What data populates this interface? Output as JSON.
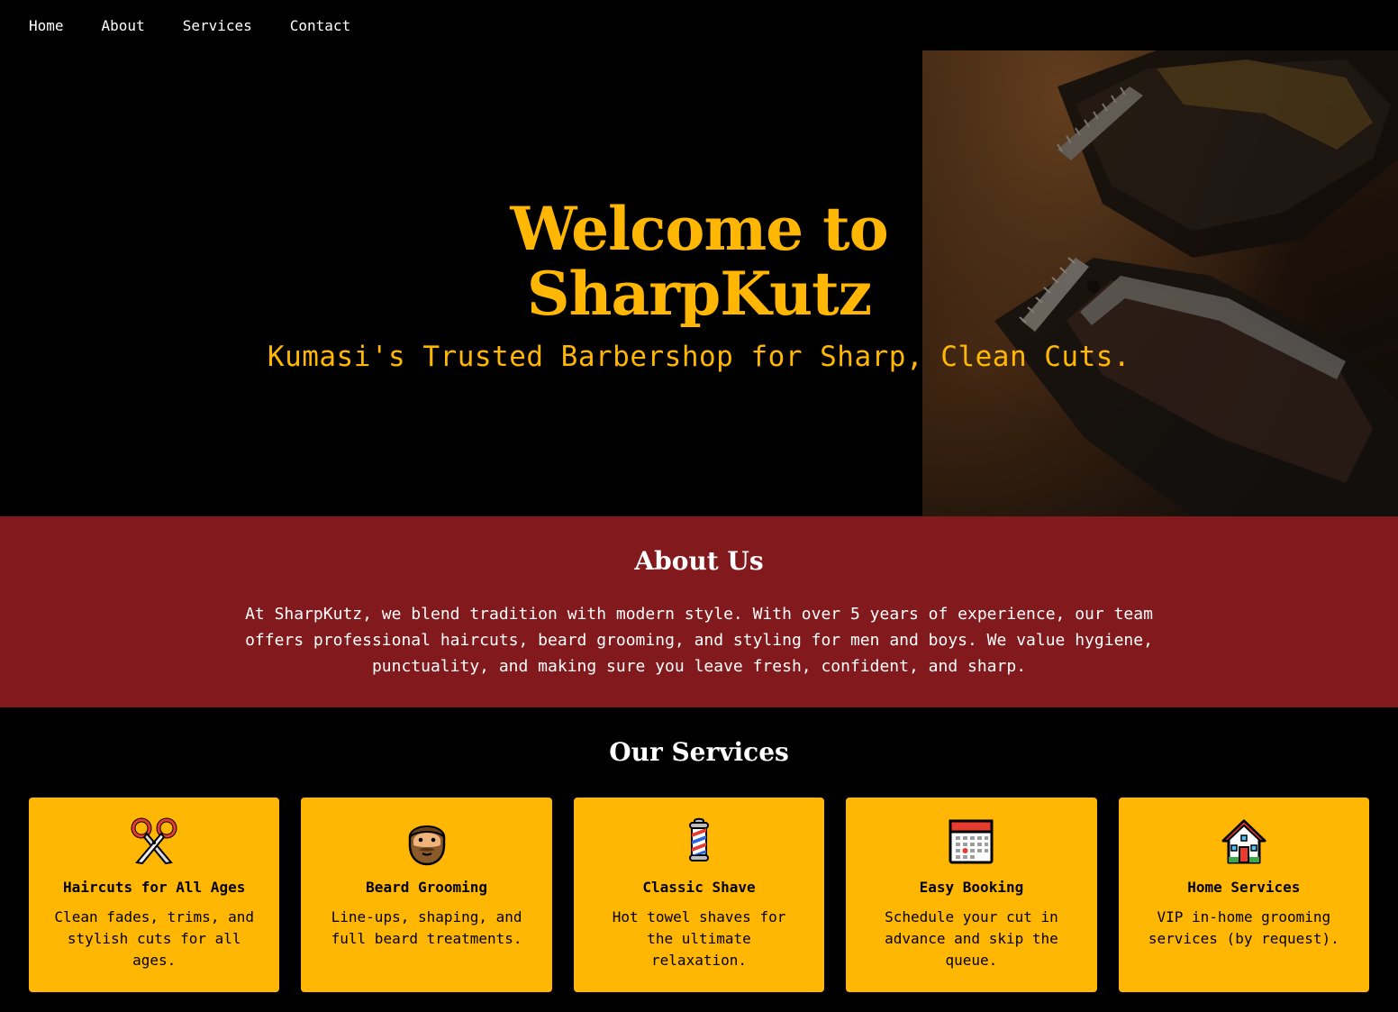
{
  "nav": {
    "items": [
      {
        "label": "Home"
      },
      {
        "label": "About"
      },
      {
        "label": "Services"
      },
      {
        "label": "Contact"
      }
    ]
  },
  "hero": {
    "title_line1": "Welcome to",
    "title_line2": "SharpKutz",
    "subtitle": "Kumasi's Trusted Barbershop for Sharp, Clean Cuts."
  },
  "about": {
    "heading": "About Us",
    "body": "At SharpKutz, we blend tradition with modern style. With over 5 years of experience, our team offers professional haircuts, beard grooming, and styling for men and boys. We value hygiene, punctuality, and making sure you leave fresh, confident, and sharp."
  },
  "services": {
    "heading": "Our Services",
    "cards": [
      {
        "icon": "scissors-icon",
        "title": "Haircuts for All Ages",
        "desc": "Clean fades, trims, and stylish cuts for all ages."
      },
      {
        "icon": "bearded-man-icon",
        "title": "Beard Grooming",
        "desc": "Line-ups, shaping, and full beard treatments."
      },
      {
        "icon": "barber-pole-icon",
        "title": "Classic Shave",
        "desc": "Hot towel shaves for the ultimate relaxation."
      },
      {
        "icon": "calendar-icon",
        "title": "Easy Booking",
        "desc": "Schedule your cut in advance and skip the queue."
      },
      {
        "icon": "house-icon",
        "title": "Home Services",
        "desc": "VIP in-home grooming services (by request)."
      }
    ]
  },
  "colors": {
    "accent": "#ffb703",
    "about_bg": "#82191c",
    "background": "#000000"
  }
}
